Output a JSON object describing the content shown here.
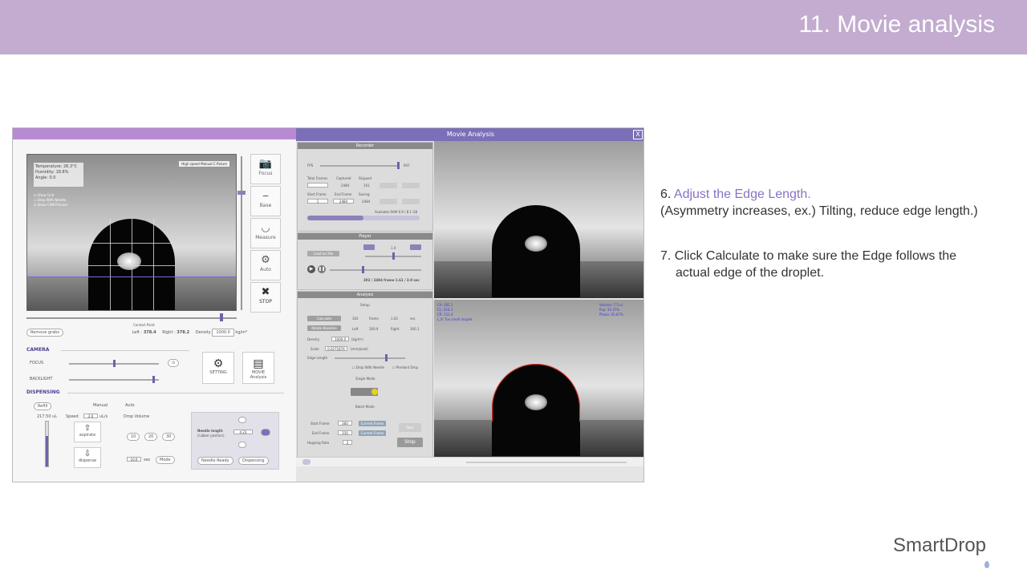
{
  "slide": {
    "title": "11. Movie analysis"
  },
  "steps": [
    {
      "number": "6.",
      "highlight": "Adjust the Edge Length.",
      "detail": "(Asymmetry increases, ex.) Tilting, reduce edge length.)"
    },
    {
      "number": "7.",
      "line1": "Click Calculate to make sure the Edge follows the",
      "line2": "actual edge of the droplet."
    }
  ],
  "brand": {
    "name": "SmartDrop"
  },
  "main_app": {
    "camera_info": [
      "Temperature: 26.3°C",
      "Humidity: 18.8%",
      "Angle: 0.0"
    ],
    "overlay_checks": [
      "Show Grid",
      "Drop With Needle",
      "Show CAM Process"
    ],
    "speed_badge": "High speed Manual C.fixture",
    "tools": [
      {
        "icon": "camera-icon",
        "glyph": "📷",
        "label": "Focus"
      },
      {
        "icon": "base-icon",
        "glyph": "⎯",
        "label": "Base"
      },
      {
        "icon": "measure-icon",
        "glyph": "◡",
        "label": "Measure"
      },
      {
        "icon": "auto-icon",
        "glyph": "⚙",
        "label": "Auto"
      },
      {
        "icon": "stop-icon",
        "glyph": "✖",
        "label": "STOP"
      }
    ],
    "measurement": {
      "button": "Remove grabs",
      "slider_label": "Contact Point",
      "left_label": "Left :",
      "left_value": "378.4",
      "right_label": "Right :",
      "right_value": "378.2",
      "density_label": "Density",
      "density_value": "1000.0",
      "density_unit": "kg/m³"
    },
    "camera": {
      "section": "CAMERA",
      "focus": "FOCUS",
      "backlight": "BACKLIGHT",
      "setting_label": "SETTING",
      "movie_label": "MOVIE Analysis"
    },
    "dispensing": {
      "section": "DISPENSING",
      "volume": "217.50",
      "volume_unit": "uL",
      "speed_label": "Speed",
      "speed_value": "2.0",
      "speed_unit": "uL/s",
      "drop_volume_label": "Drop Volume",
      "drop_sizes": [
        "10",
        "20",
        "30"
      ],
      "drop_value": "10.0",
      "drop_unit": "sec",
      "mode_button": "Mode",
      "refill": "Refill",
      "manual_label": "Manual",
      "auto_label": "Auto",
      "up_label": "aspirate",
      "down_label": "dispense",
      "needle_label": "Needle length",
      "needle_sub": "(rubber position)",
      "needle_value": "4.23",
      "needle_ready": "Needle Ready",
      "dispensing_btn": "Dispensing"
    }
  },
  "movie_window": {
    "title": "Movie Analysis",
    "close": "X",
    "recorder": {
      "head": "Recorder",
      "fps_label": "FPS",
      "fps_value": "947",
      "cols": [
        "Total Frames",
        "Captured",
        "Skipped"
      ],
      "vals": [
        "",
        "2484",
        "101"
      ],
      "start_label": "Start Frame",
      "end_label": "End Frame",
      "saving_label": "Saving",
      "start_value": "1",
      "end_value": "2484",
      "saving_value": "2484",
      "status": "Available RAM 6.9 / 8.1 GB"
    },
    "player": {
      "head": "Player",
      "load_btn": "Load avi file",
      "speed": "1.0",
      "frame_text": "302 / 2484 frame  1.61 / 3.9 sec"
    },
    "analysis": {
      "head": "Analysis",
      "setup_label": "Setup",
      "calc_btn": "Calculate",
      "frame_label": "frame",
      "frame_value": "302",
      "time_value": "1.62",
      "time_unit": "sec",
      "left_label": "Left",
      "left_value": "300.9",
      "right_label": "Right",
      "right_value": "300.1",
      "remove_btn": "Rotate Baseline",
      "density_label": "Density",
      "density_value": "1000.0",
      "density_unit": "(kg/m³)",
      "scale_label": "Scale",
      "scale_value": "0.0271874",
      "scale_unit": "(mm/pixel)",
      "edge_label": "Edge Length",
      "drop_needle": "Drop With Needle",
      "pendant": "Pendant Drop",
      "single_label": "Single Mode",
      "batch_label": "Batch Mode",
      "start_frame_label": "Start Frame",
      "start_frame_value": "300",
      "end_frame_label": "End Frame",
      "end_frame_value": "310",
      "hopping_label": "Hopping Rate",
      "hopping_value": "2",
      "current_frame": "Current Frame",
      "start_btn": "Start",
      "stop_btn": "Stop"
    },
    "overlay_left": [
      "CA: 102.1",
      "CL: 154.3",
      "CR: 112.4",
      "L_R: Too small droplet"
    ],
    "overlay_right": [
      "Volume: 7.5 ul",
      "Pop: 32.47%",
      "Phase: 05.87%"
    ]
  }
}
